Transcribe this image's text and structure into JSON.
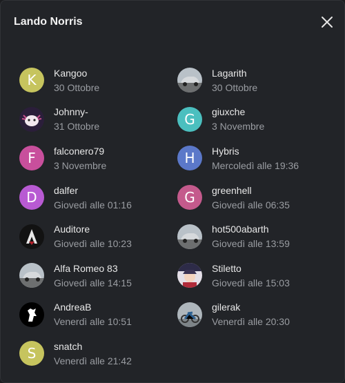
{
  "dialog": {
    "title": "Lando Norris"
  },
  "users": [
    {
      "name": "Kangoo",
      "date": "30 Ottobre",
      "avatar": "letter",
      "letter": "K",
      "color": "#c6c45e"
    },
    {
      "name": "Lagarith",
      "date": "30 Ottobre",
      "avatar": "car-photo"
    },
    {
      "name": "Johnny-",
      "date": "31 Ottobre",
      "avatar": "axolotl-photo"
    },
    {
      "name": "giuxche",
      "date": "3 Novembre",
      "avatar": "letter",
      "letter": "G",
      "color": "#4bbfbf"
    },
    {
      "name": "falconero79",
      "date": "3 Novembre",
      "avatar": "letter",
      "letter": "F",
      "color": "#c84f9c"
    },
    {
      "name": "Hybris",
      "date": "Mercoledì alle 19:36",
      "avatar": "letter",
      "letter": "H",
      "color": "#5b78c9"
    },
    {
      "name": "dalfer",
      "date": "Giovedì alle 01:16",
      "avatar": "letter",
      "letter": "D",
      "color": "#b85ad3"
    },
    {
      "name": "greenhell",
      "date": "Giovedì alle 06:35",
      "avatar": "letter",
      "letter": "G",
      "color": "#c45a8c"
    },
    {
      "name": "Auditore",
      "date": "Giovedì alle 10:23",
      "avatar": "assassin-logo"
    },
    {
      "name": "hot500abarth",
      "date": "Giovedì alle 13:59",
      "avatar": "car-photo"
    },
    {
      "name": "Alfa Romeo 83",
      "date": "Giovedì alle 14:15",
      "avatar": "car-photo"
    },
    {
      "name": "Stiletto",
      "date": "Giovedì alle 15:03",
      "avatar": "anime-photo"
    },
    {
      "name": "AndreaB",
      "date": "Venerdì alle 10:51",
      "avatar": "horse-logo"
    },
    {
      "name": "gilerak",
      "date": "Venerdì alle 20:30",
      "avatar": "motorbike-photo"
    },
    {
      "name": "snatch",
      "date": "Venerdì alle 21:42",
      "avatar": "letter",
      "letter": "S",
      "color": "#c6c45e"
    }
  ]
}
